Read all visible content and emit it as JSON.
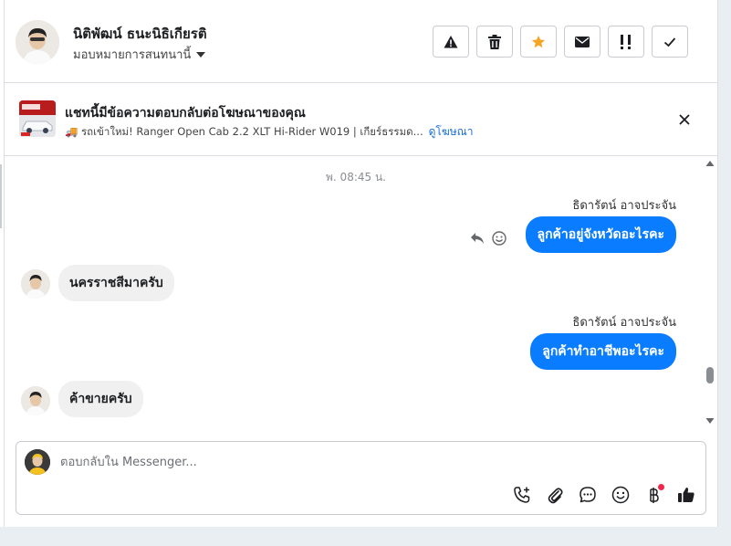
{
  "header": {
    "contact_name": "นิติพัฒน์ ธนะนิธิเกียรติ",
    "assign_label": "มอบหมายการสนทนานี้",
    "actions": [
      {
        "name": "spam-icon",
        "color": "#1c1e21"
      },
      {
        "name": "trash-icon",
        "color": "#1c1e21"
      },
      {
        "name": "star-icon",
        "color": "#f5a524"
      },
      {
        "name": "mail-icon",
        "color": "#1c1e21"
      },
      {
        "name": "follow-up-icon",
        "color": "#1c1e21"
      },
      {
        "name": "check-icon",
        "color": "#1c1e21"
      }
    ]
  },
  "ad_banner": {
    "title": "แชทนี้มีข้อความตอบกลับต่อโฆษณาของคุณ",
    "description": "🚚 รถเข้าใหม่! Ranger Open Cab 2.2 XLT Hi-Rider W019 | เกียร์ธรรมด...",
    "link_label": "ดูโฆษณา"
  },
  "messages": {
    "timestamp": "พ. 08:45 น.",
    "items": [
      {
        "direction": "out",
        "sender": "ธิดารัตน์ อาจประจัน",
        "text": "ลูกค้าอยู่จังหวัดอะไรคะ"
      },
      {
        "direction": "in",
        "text": "นครราชสีมาครับ"
      },
      {
        "direction": "out",
        "sender": "ธิดารัตน์ อาจประจัน",
        "text": "ลูกค้าทำอาชีพอะไรคะ"
      },
      {
        "direction": "in",
        "text": "ค้าขายครับ"
      }
    ]
  },
  "composer": {
    "placeholder": "ตอบกลับใน Messenger...",
    "tools": [
      "call-add-icon",
      "attachment-icon",
      "saved-replies-icon",
      "emoji-icon",
      "payment-icon",
      "like-icon"
    ]
  },
  "colors": {
    "accent": "#0a7cff",
    "incoming_bubble": "#f0f0f0",
    "notification_dot": "#f02849"
  }
}
